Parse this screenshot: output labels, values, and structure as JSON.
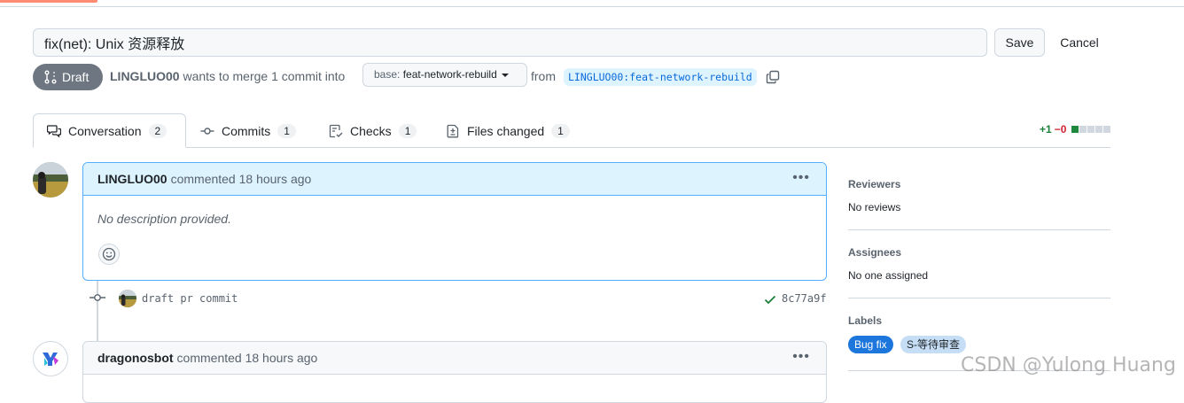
{
  "pr": {
    "title": "fix(net): Unix 资源释放",
    "save_label": "Save",
    "cancel_label": "Cancel",
    "state_label": "Draft",
    "author": "LINGLUO00",
    "merge_text": "wants to merge 1 commit into",
    "base_prefix": "base:",
    "base_branch": "feat-network-rebuild",
    "from_text": "from",
    "head_branch": "LINGLUO00:feat-network-rebuild"
  },
  "tabs": [
    {
      "label": "Conversation",
      "count": "2"
    },
    {
      "label": "Commits",
      "count": "1"
    },
    {
      "label": "Checks",
      "count": "1"
    },
    {
      "label": "Files changed",
      "count": "1"
    }
  ],
  "diffstat": {
    "additions": "+1",
    "deletions": "−0"
  },
  "comments": [
    {
      "author": "LINGLUO00",
      "meta": "commented 18 hours ago",
      "body": "No description provided."
    },
    {
      "author": "dragonosbot",
      "meta": "commented 18 hours ago"
    }
  ],
  "commit": {
    "message": "draft pr commit",
    "sha": "8c77a9f"
  },
  "sidebar": {
    "reviewers_title": "Reviewers",
    "reviewers_value": "No reviews",
    "assignees_title": "Assignees",
    "assignees_value": "No one assigned",
    "labels_title": "Labels",
    "labels": [
      "Bug fix",
      "S-等待审查"
    ]
  },
  "watermark": "CSDN @Yulong Huang",
  "colors": {
    "draft": "#6e7781",
    "link": "#0969da",
    "comment_border": "#54aeff",
    "add": "#1a7f37",
    "delete": "#d1242f",
    "label_bugfix": "#1d76db",
    "label_review": "#c5def5"
  },
  "icons": [
    "draft-pr-icon",
    "caret-down-icon",
    "copy-icon",
    "comment-discussion-icon",
    "git-commit-icon",
    "checklist-icon",
    "file-diff-icon",
    "kebab-horizontal-icon",
    "smiley-icon",
    "check-icon"
  ]
}
